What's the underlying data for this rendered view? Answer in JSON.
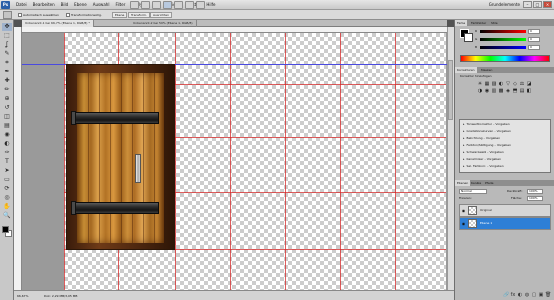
{
  "app": {
    "logo": "Ps",
    "workspace": "Grundelemente"
  },
  "menu": [
    "Datei",
    "Bearbeiten",
    "Bild",
    "Ebene",
    "Auswahl",
    "Filter",
    "Analyse",
    "3D",
    "Ansicht",
    "Fenster",
    "Hilfe"
  ],
  "window_controls": {
    "minimize": "–",
    "maximize": "□",
    "close": "×"
  },
  "options": {
    "autoselect_label": "Automatisch auswählen",
    "transform_label": "Transformationsstrg.",
    "btn1": "Ebene",
    "btn2": "Transform.",
    "btn3": "Ausrichten"
  },
  "tabs": [
    {
      "label": "Unbenannt-1 bei 66,7% (Ebene 1, RGB/8) *"
    },
    {
      "label": "Unbenannt-2 bei 50% (Ebene 1, RGB/8)"
    }
  ],
  "toolbox": {
    "tools": [
      "move-icon",
      "marquee-icon",
      "lasso-icon",
      "quick-select-icon",
      "crop-icon",
      "eyedropper-icon",
      "healing-icon",
      "brush-icon",
      "stamp-icon",
      "history-brush-icon",
      "eraser-icon",
      "gradient-icon",
      "blur-icon",
      "dodge-icon",
      "pen-icon",
      "type-icon",
      "path-select-icon",
      "shape-icon",
      "3d-rotate-icon",
      "3d-orbit-icon",
      "hand-icon",
      "zoom-icon"
    ],
    "glyphs": [
      "✥",
      "⬚",
      "ʆ",
      "✎",
      "⌗",
      "✒",
      "✚",
      "✏",
      "⊕",
      "↺",
      "◫",
      "▤",
      "◉",
      "◐",
      "✑",
      "T",
      "➤",
      "▭",
      "⟳",
      "◎",
      "✋",
      "🔍"
    ],
    "foreground_color": "#000000",
    "background_color": "#ffffff"
  },
  "status": {
    "zoom": "66,67%",
    "info": "Dok: 2,29 MB/3,05 MB"
  },
  "panels": {
    "color_tabs": [
      "Farbe",
      "Farbfelder",
      "Stile"
    ],
    "color_channels": [
      {
        "label": "R",
        "value": "0"
      },
      {
        "label": "G",
        "value": "0"
      },
      {
        "label": "B",
        "value": "0"
      }
    ],
    "adjust_tabs": [
      "Korrekturen",
      "Masken"
    ],
    "adjust_title": "Korrektur hinzufügen",
    "adjust_icons": [
      "☀",
      "▦",
      "▨",
      "◐",
      "▽",
      "◇",
      "⚖",
      "◪",
      "◑",
      "◉",
      "▥",
      "▩",
      "◈",
      "⬒",
      "▤",
      "◧"
    ],
    "presets": [
      "Tonwertkorrektur – Vorgaben",
      "Gradationskurven – Vorgaben",
      "Belichtung – Vorgaben",
      "Farbton/Sättigung – Vorgaben",
      "Schwarzweiß – Vorgaben",
      "Kanalmixer – Vorgaben",
      "Sel. Farbkorr. – Vorgaben"
    ],
    "layer_tabs": [
      "Ebenen",
      "Kanäle",
      "Pfade"
    ],
    "blend_mode": "Normal",
    "opacity_label": "Deckkraft:",
    "opacity": "100%",
    "fill_label": "Fläche:",
    "fill": "100%",
    "lock_label": "Fixieren:",
    "layers": [
      {
        "name": "Original",
        "selected": false
      },
      {
        "name": "Ebene 1",
        "selected": true
      }
    ],
    "bottom_icons": [
      "🔗",
      "fx",
      "◐",
      "◍",
      "▢",
      "▣",
      "🗑"
    ]
  }
}
